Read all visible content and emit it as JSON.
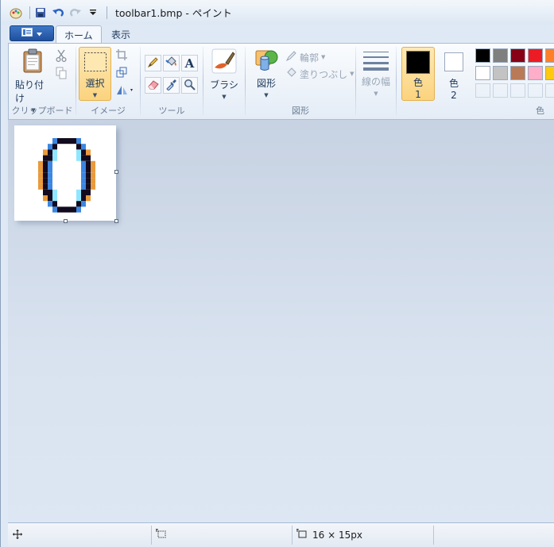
{
  "window": {
    "title": "toolbar1.bmp - ペイント"
  },
  "tabs": [
    {
      "label": "ホーム",
      "active": true
    },
    {
      "label": "表示",
      "active": false
    }
  ],
  "groups": {
    "clipboard": {
      "label": "クリップボード",
      "paste_label": "貼り付け"
    },
    "image": {
      "label": "イメージ",
      "select_label": "選択"
    },
    "tools": {
      "label": "ツール"
    },
    "brushes": {
      "brush_label": "ブラシ"
    },
    "shapes": {
      "label": "図形",
      "shapes_label": "図形",
      "outline_label": "輪郭",
      "fill_label": "塗りつぶし"
    },
    "size": {
      "label": "線の幅"
    },
    "colors": {
      "label": "色",
      "color1_label": "色",
      "color1_num": "1",
      "color2_label": "色",
      "color2_num": "2",
      "color1_value": "#000000",
      "color2_value": "#ffffff"
    }
  },
  "palette": {
    "row1": [
      "#000000",
      "#7f7f7f",
      "#880015",
      "#ed1c24",
      "#ff7f27"
    ],
    "row2": [
      "#ffffff",
      "#c3c3c3",
      "#b97a57",
      "#ffaec9",
      "#ffc90e"
    ],
    "row3": [
      "",
      "",
      "",
      "",
      ""
    ]
  },
  "canvas": {
    "drawn_glyph": "0"
  },
  "statusbar": {
    "image_size": "16 × 15px"
  },
  "icons": {
    "app": "paint-app-icon",
    "save": "save-icon",
    "undo": "undo-icon",
    "redo": "redo-icon"
  }
}
